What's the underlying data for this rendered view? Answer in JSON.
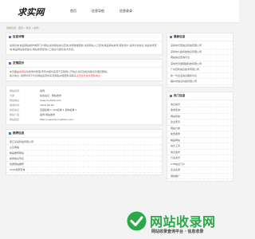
{
  "header": {
    "logo": "求实网",
    "nav": [
      "首页",
      "信息导航",
      "信息收录"
    ]
  },
  "breadcrumb": "当前位置：首页 » 信息 » 案例",
  "panels": {
    "detail": {
      "title": "信息详情",
      "text": "案例系统,精品网站制作推荐门户网站,提供网站信息查询,收录数据更新,免费网站入口查询,精品网站收录,服务用户,提供分类信息,快速收录查询,精品网站免费提交,网站收录查询入口信息与服务技术支持。"
    },
    "notice": {
      "title": "友情提示",
      "line1_pre": "本页面由",
      "line1_hl": "案例系统",
      "line1_post": "收录并整理,所有内容均来源于互联网公开信息,如有侵权请联系管理员删除。",
      "line2_pre": "提示信息: 收录时间不代表网站运营时间,若网站内容更新请联系",
      "line2_hl": "点击此处提交更新信息"
    },
    "info": {
      "rows": [
        {
          "k": "网站名称:",
          "v": "案例"
        },
        {
          "k": "分类:",
          "v": "综合站点 · 网站收录"
        },
        {
          "k": "",
          "v": ""
        },
        {
          "k": "网站地址:",
          "v": "www.mythite.com"
        },
        {
          "k": "收录时间:",
          "v": "2020-04-29"
        },
        {
          "k": "排名信息:",
          "v": "百度权重:1 360权重:1 搜狗权重:1"
        },
        {
          "k": "网站介绍:",
          "v": "案例·网站收录"
        },
        {
          "k": "网站链接:",
          "v": "http://caselink.mythite.com/"
        }
      ]
    },
    "recommend": {
      "title": "推荐信息",
      "items": [
        "浙江某某科技有限公司",
        "山东网络",
        "精品推荐网站",
        "案例信息列表",
        "优质网站推荐",
        "ASOI收录查询"
      ]
    }
  },
  "side": {
    "latest": {
      "title": "最新信息",
      "items": [
        "深圳市乐康信息科技有限公司",
        "深圳市众鑫科技信息有限公司",
        "网站信息查询平台",
        "深圳市天翼网络科技有限公司",
        "广州百利信息技术有限公司",
        "新一代企业信息服务平台",
        "福州市信息科技有限公司"
      ]
    },
    "hot": {
      "title": "热门信息",
      "items": [
        "信息快讯",
        "收录查询",
        "网站导航",
        "企业黄页",
        "网站分类",
        "免费收录",
        "精品网站",
        "站长工具",
        "信息发布",
        "行业资讯",
        "CTN信息门户",
        "企业名录",
        "网站推广"
      ]
    }
  },
  "watermark": {
    "text": "网站收录网",
    "sub": "网站收录查询平台 · 信息收录"
  }
}
